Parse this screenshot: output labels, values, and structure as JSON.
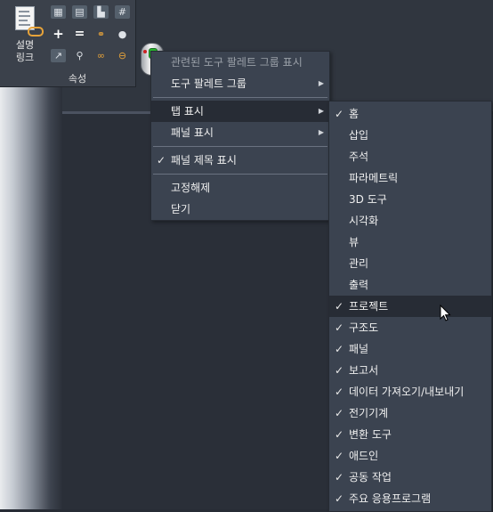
{
  "ribbon": {
    "big_button_label_line1": "설명",
    "big_button_label_line2": "링크",
    "panel_title": "속성"
  },
  "context_menu": {
    "header": "관련된 도구 팔레트 그룹 표시",
    "items": [
      {
        "label": "도구 팔레트 그룹",
        "submenu": true
      },
      {
        "label": "탭 표시",
        "submenu": true,
        "highlighted": true
      },
      {
        "label": "패널 표시",
        "submenu": true
      },
      {
        "label": "패널 제목 표시",
        "checked": true
      },
      {
        "label": "고정해제"
      },
      {
        "label": "닫기"
      }
    ]
  },
  "tabs_submenu": {
    "items": [
      {
        "label": "홈",
        "checked": true
      },
      {
        "label": "삽입",
        "checked": false
      },
      {
        "label": "주석",
        "checked": false
      },
      {
        "label": "파라메트릭",
        "checked": false
      },
      {
        "label": "3D 도구",
        "checked": false
      },
      {
        "label": "시각화",
        "checked": false
      },
      {
        "label": "뷰",
        "checked": false
      },
      {
        "label": "관리",
        "checked": false
      },
      {
        "label": "출력",
        "checked": false
      },
      {
        "label": "프로젝트",
        "checked": true,
        "hovered": true
      },
      {
        "label": "구조도",
        "checked": true
      },
      {
        "label": "패널",
        "checked": true
      },
      {
        "label": "보고서",
        "checked": true
      },
      {
        "label": "데이터 가져오기/내보내기",
        "checked": true
      },
      {
        "label": "전기기계",
        "checked": true
      },
      {
        "label": "변환 도구",
        "checked": true
      },
      {
        "label": "애드인",
        "checked": true
      },
      {
        "label": "공동 작업",
        "checked": true
      },
      {
        "label": "주요 응용프로그램",
        "checked": true
      }
    ]
  },
  "glyphs": {
    "check": "✓",
    "arrow": "▶"
  }
}
